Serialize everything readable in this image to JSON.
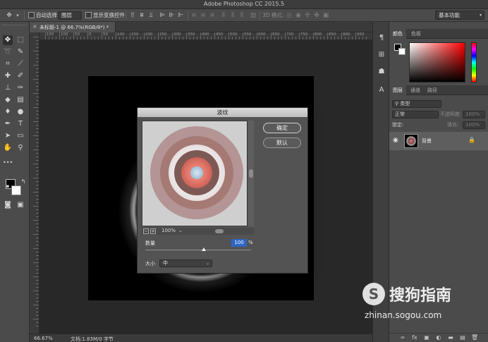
{
  "app": {
    "title": "Adobe Photoshop CC 2015.5"
  },
  "options_bar": {
    "auto_select_label": "自动选择:",
    "auto_select_target": "图层",
    "show_transform_label": "显示变换控件",
    "mode_3d_label": "3D 模式:"
  },
  "workspace": {
    "selected": "基本功能"
  },
  "document": {
    "tab_title": "未标题-1 @ 66.7%(RGB/8*) *",
    "close_glyph": "×"
  },
  "ruler": {
    "ticks": [
      "150",
      "100",
      "50",
      "0",
      "50",
      "100",
      "150",
      "200",
      "250",
      "300",
      "350",
      "400",
      "450",
      "500",
      "550",
      "600",
      "650",
      "700",
      "750",
      "800",
      "850",
      "900",
      "950"
    ]
  },
  "status": {
    "zoom": "66.67%",
    "doc_info": "文档:1.83M/0 字节",
    "arrow": "›"
  },
  "panels": {
    "color_tabs": [
      "颜色",
      "色板"
    ],
    "layers_tabs": [
      "图层",
      "通道",
      "路径"
    ],
    "kind_filter": "类型",
    "blend_mode": "正常",
    "opacity_label": "不透明度:",
    "opacity_value": "100%",
    "lock_label": "锁定:",
    "fill_label": "填充:",
    "fill_value": "100%",
    "layer_name": "背景",
    "footer_icons": [
      "∞",
      "fx",
      "▣",
      "◐",
      "▬",
      "▤",
      "🗑"
    ]
  },
  "dialog": {
    "title": "波纹",
    "ok_label": "确定",
    "default_label": "默认",
    "preview_zoom": "100%",
    "amount_label": "数量",
    "amount_value": "100",
    "amount_unit": "%",
    "amount_slider_fraction": 0.55,
    "size_label": "大小",
    "size_value": "中",
    "zoom_out": "−",
    "zoom_in": "+"
  },
  "watermark": {
    "logo_letter": "S",
    "brand": "搜狗指南",
    "url": "zhinan.sogou.com"
  },
  "colors": {
    "foreground": "#000000",
    "background": "#ffffff",
    "dialog_title": "#c9c9c9",
    "amount_highlight": "#2f66c4"
  }
}
